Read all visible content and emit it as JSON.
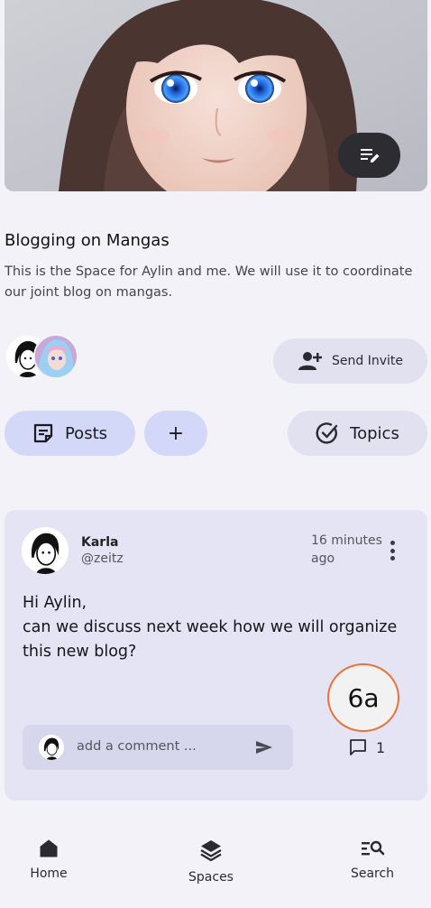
{
  "banner": {
    "image_alt": "anime girl portrait"
  },
  "space": {
    "title": "Blogging on Mangas",
    "description": "This is the Space for Aylin and me. We will use it to coordinate our joint blog on mangas."
  },
  "actions": {
    "send_invite": "Send Invite",
    "posts": "Posts",
    "add": "+",
    "topics": "Topics"
  },
  "post": {
    "author_name": "Karla",
    "author_handle": "@zeitz",
    "time_line1": "16 minutes",
    "time_line2": "ago",
    "body_line1": "Hi Aylin,",
    "body_line2": "can we discuss next week how we will organize",
    "body_line3": "this new blog?",
    "comment_placeholder": "add a comment ...",
    "comment_count": "1"
  },
  "annotation": {
    "label": "6a",
    "color": "#e6743a"
  },
  "nav": {
    "home": "Home",
    "spaces": "Spaces",
    "search": "Search"
  },
  "colors": {
    "background": "#f3f2f9",
    "primary_pill": "#d3d8f8",
    "secondary_pill": "#e1e1f0",
    "card": "#e4e4f4"
  }
}
